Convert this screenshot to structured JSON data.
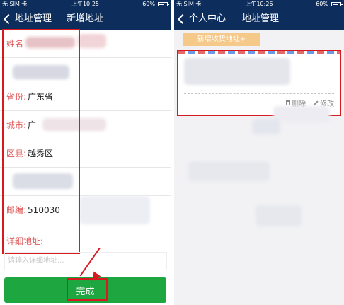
{
  "left": {
    "status": {
      "carrier": "无 SIM 卡",
      "time": "上午10:25",
      "battery": "60%"
    },
    "nav": {
      "back_label": "地址管理",
      "title": "新增地址"
    },
    "fields": {
      "name_label": "姓名",
      "province_label": "省份:",
      "province_value": "广东省",
      "city_label": "城市:",
      "city_value": "广",
      "district_label": "区县:",
      "district_value": "越秀区",
      "postcode_label": "邮编:",
      "postcode_value": "510030",
      "detail_label": "详细地址:"
    },
    "detail_placeholder": "请输入详细地址...",
    "done_label": "完成"
  },
  "right": {
    "status": {
      "carrier": "无 SIM 卡",
      "time": "上午10:26",
      "battery": "60%"
    },
    "nav": {
      "back_label": "个人中心",
      "title": "地址管理"
    },
    "add_label": "新增收货地址+",
    "delete_label": "删除",
    "edit_label": "修改"
  },
  "colors": {
    "navbar": "#0d2e5c",
    "done": "#1ea640",
    "annotation": "#d71920",
    "add_button": "#f5c98a"
  }
}
